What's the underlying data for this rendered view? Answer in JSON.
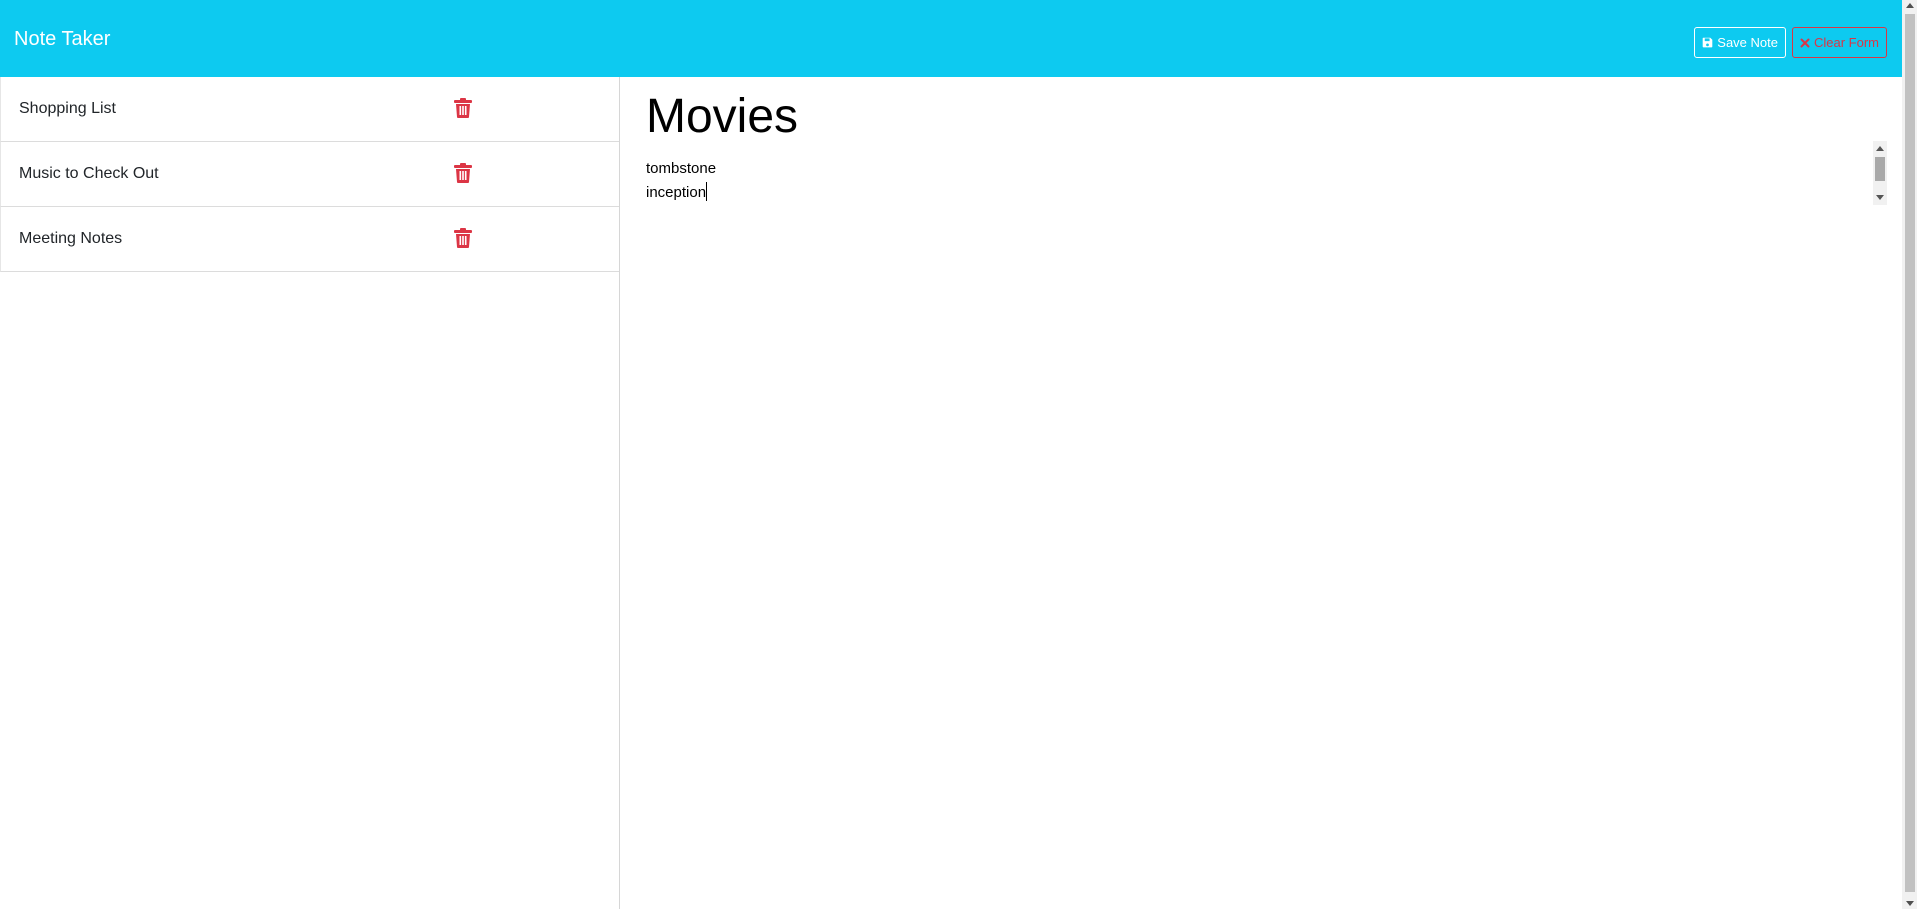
{
  "app": {
    "title": "Note Taker",
    "colors": {
      "navbar": "#0dcaf0",
      "danger": "#dc3545",
      "text": "#212529"
    }
  },
  "toolbar": {
    "save_label": "Save Note",
    "save_icon": "floppy-disk-icon",
    "clear_label": "Clear Form",
    "clear_icon": "x-icon"
  },
  "sidebar": {
    "notes": [
      {
        "title": "Shopping List",
        "icon": "trash-icon"
      },
      {
        "title": "Music to Check Out",
        "icon": "trash-icon"
      },
      {
        "title": "Meeting Notes",
        "icon": "trash-icon"
      }
    ]
  },
  "editor": {
    "title": "Movies",
    "body_lines": [
      "tombstone",
      "inception"
    ]
  }
}
